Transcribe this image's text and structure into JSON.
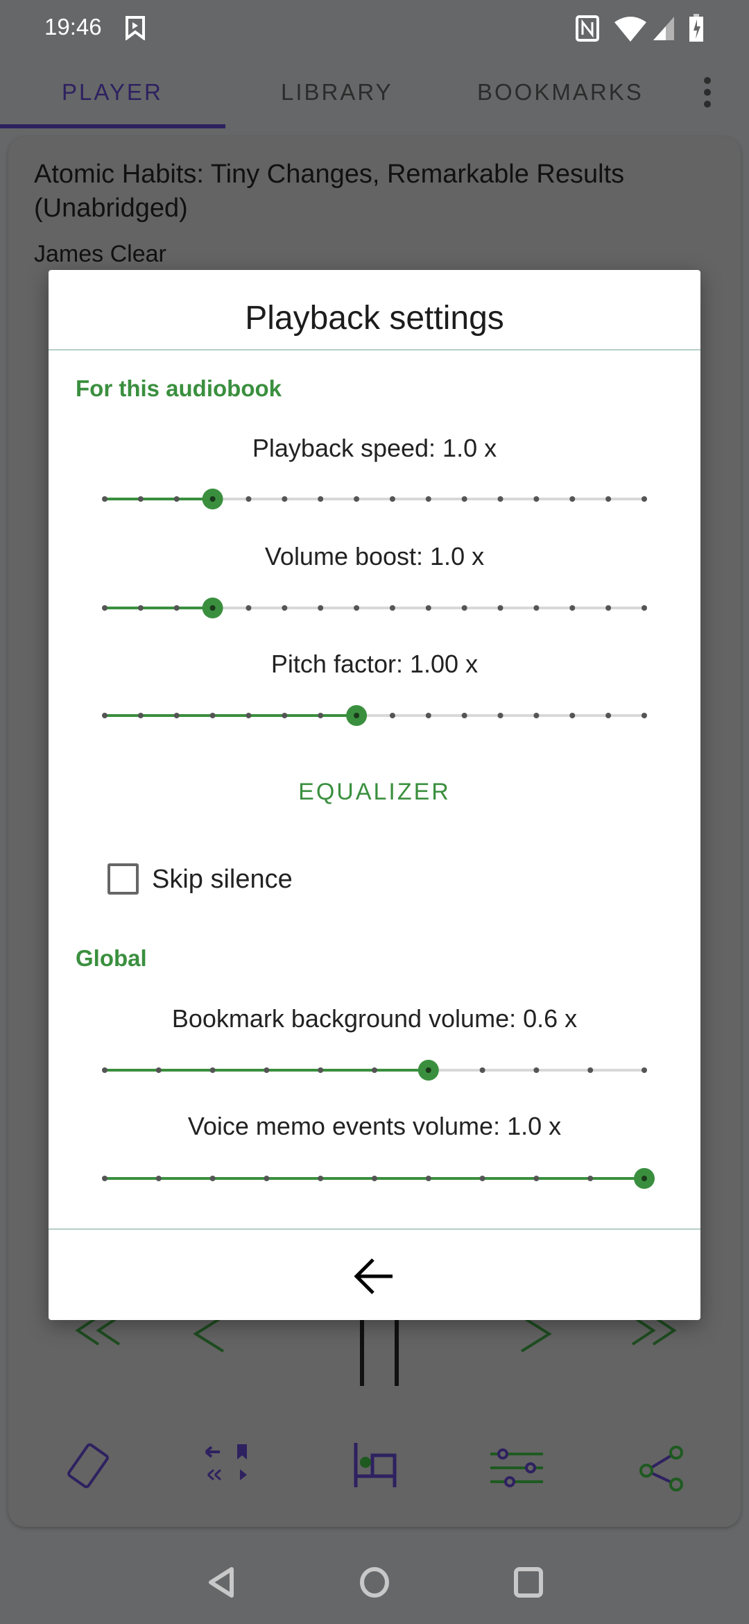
{
  "status_bar": {
    "time": "19:46",
    "icons": [
      "bookmark-play-icon",
      "nfc-icon",
      "wifi-icon",
      "signal-icon",
      "battery-charging-icon"
    ]
  },
  "tabs": [
    {
      "label": "PLAYER",
      "active": true
    },
    {
      "label": "LIBRARY",
      "active": false
    },
    {
      "label": "BOOKMARKS",
      "active": false
    }
  ],
  "book": {
    "title_line1": "Atomic Habits: Tiny Changes, Remarkable Results",
    "title_line2": "(Unabridged)",
    "author": "James Clear"
  },
  "colors": {
    "accent": "#3a8f3e",
    "tab_active": "#2e2160",
    "track": "#d8d8d8"
  },
  "dialog": {
    "title": "Playback settings",
    "section_book": "For this audiobook",
    "playback_speed": {
      "label": "Playback speed: 1.0 x",
      "steps": 16,
      "index": 3
    },
    "volume_boost": {
      "label": "Volume boost: 1.0 x",
      "steps": 16,
      "index": 3
    },
    "pitch_factor": {
      "label": "Pitch factor: 1.00 x",
      "steps": 16,
      "index": 7
    },
    "equalizer_label": "EQUALIZER",
    "skip_silence": {
      "label": "Skip silence",
      "checked": false
    },
    "section_global": "Global",
    "bookmark_volume": {
      "label": "Bookmark background volume: 0.6 x",
      "steps": 11,
      "index": 6
    },
    "voice_memo_volume": {
      "label": "Voice memo events volume: 1.0 x",
      "steps": 11,
      "index": 10
    },
    "back_icon": "arrow-left-icon"
  }
}
